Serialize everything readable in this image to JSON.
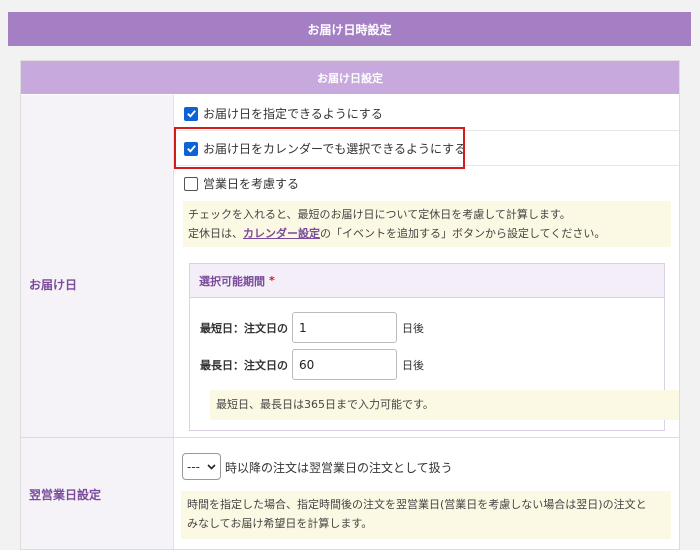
{
  "page": {
    "title": "お届け日時設定"
  },
  "section": {
    "title": "お届け日設定"
  },
  "delivery": {
    "label": "お届け日",
    "options": [
      {
        "label": "お届け日を指定できるようにする",
        "checked": true
      },
      {
        "label": "お届け日をカレンダーでも選択できるようにする",
        "checked": true
      },
      {
        "label": "営業日を考慮する",
        "checked": false
      }
    ],
    "note_line1": "チェックを入れると、最短のお届け日について定休日を考慮して計算します。",
    "note_line2_pre": "定休日は、",
    "note_link": "カレンダー設定",
    "note_line2_post": "の「イベントを追加する」ボタンから設定してください。",
    "period": {
      "title": "選択可能期間",
      "required_mark": "*",
      "min_label": "最短日：注文日の",
      "min_value": "1",
      "max_label": "最長日：注文日の",
      "max_value": "60",
      "suffix": "日後",
      "note": "最短日、最長日は365日まで入力可能です。"
    }
  },
  "next_day": {
    "label": "翌営業日設定",
    "select_value": "---",
    "select_text": "時以降の注文は翌営業日の注文として扱う",
    "note_line1": "時間を指定した場合、指定時間後の注文を翌営業日(営業日を考慮しない場合は翌日)の注文と",
    "note_line2": "みなしてお届け希望日を計算します。"
  },
  "colors": {
    "header": "#a57fc4",
    "section_header": "#c7a9de",
    "label_text": "#7a4a9b",
    "checkbox_on": "#0b63d6",
    "highlight": "#d21c1c",
    "note_bg": "#fbf8e3"
  }
}
